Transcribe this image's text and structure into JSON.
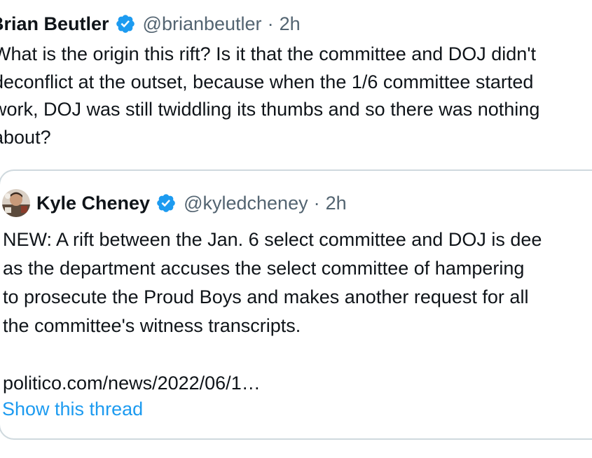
{
  "tweet": {
    "author_name": "Brian Beutler",
    "author_handle": "@brianbeutler",
    "separator": "·",
    "time": "2h",
    "text": "What is the origin this rift? Is it that the committee and DOJ didn't\ndeconflict at the outset, because when the 1/6 committee started\nwork, DOJ was still twiddling its thumbs and so there was nothing\nabout?"
  },
  "quoted_tweet": {
    "author_name": "Kyle Cheney",
    "author_handle": "@kyledcheney",
    "separator": "·",
    "time": "2h",
    "text": "NEW: A rift between the Jan. 6 select committee and DOJ is dee\nas the department accuses the select committee of hampering\nto prosecute the Proud Boys and makes another request for all\nthe committee's witness transcripts.",
    "link": "politico.com/news/2022/06/1…",
    "show_thread": "Show this thread"
  },
  "icons": {
    "verified": "verified-badge-icon",
    "avatar": "kyle-cheney-avatar"
  },
  "colors": {
    "verified_blue": "#1d9bf0",
    "link_blue": "#1d9bf0",
    "secondary_text": "#536471",
    "border": "#cfd9de"
  }
}
